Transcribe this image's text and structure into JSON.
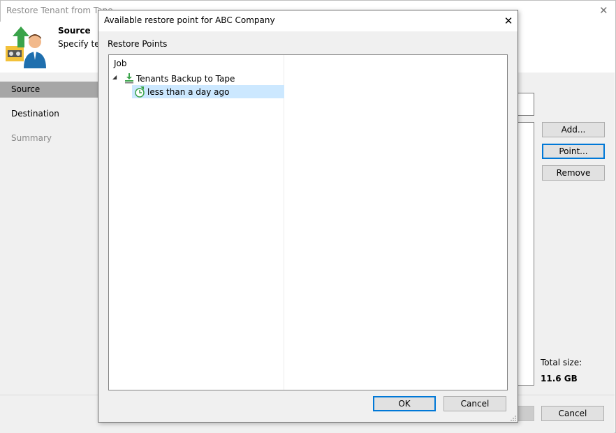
{
  "wizard": {
    "title": "Restore Tenant from Tape",
    "step_title": "Source",
    "step_description": "Specify ten",
    "nav": [
      {
        "label": "Source"
      },
      {
        "label": "Destination"
      },
      {
        "label": "Summary"
      }
    ],
    "buttons": {
      "add": "Add...",
      "point": "Point...",
      "remove": "Remove",
      "cancel": "Cancel"
    },
    "total_size_label": "Total size:",
    "total_size_value": "11.6 GB"
  },
  "dialog": {
    "title": "Available restore point for ABC Company",
    "section_label": "Restore Points",
    "column_header": "Job",
    "tree": {
      "job": {
        "label": "Tenants Backup to Tape",
        "icon": "tape-backup-job-icon"
      },
      "restore_point": {
        "label": "less than a day ago",
        "icon": "restore-point-clock-icon"
      }
    },
    "buttons": {
      "ok": "OK",
      "cancel": "Cancel"
    }
  },
  "colors": {
    "selection": "#cce8ff",
    "accent": "#0078d7",
    "nav_selected": "#a6a6a6",
    "icon_green": "#3aa34a"
  }
}
